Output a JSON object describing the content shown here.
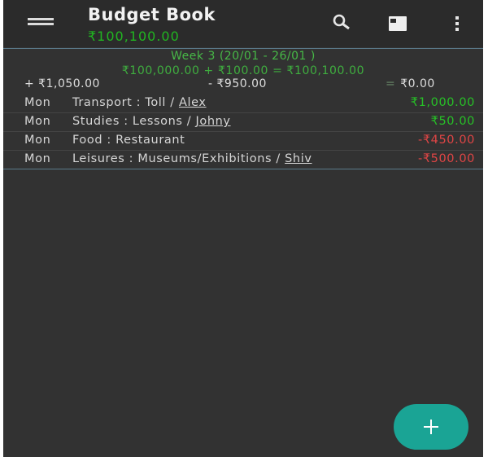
{
  "appbar": {
    "title": "Budget Book",
    "balance": "₹100,100.00"
  },
  "icons": {
    "menu": "menu-icon",
    "search": "search-icon",
    "card": "card-view-icon",
    "more": "more-vert-icon",
    "fab": "plus-icon"
  },
  "week": {
    "title": "Week 3 (20/01 - 26/01 )",
    "formula": "₹100,000.00 + ₹100.00 = ₹100,100.00",
    "income": "+ ₹1,050.00",
    "expense": "- ₹950.00",
    "diff_sign": "=",
    "diff": "₹0.00"
  },
  "transactions": [
    {
      "day": "Mon",
      "desc": "Transport : Toll / ",
      "who": "Alex",
      "amount": "₹1,000.00",
      "type": "income"
    },
    {
      "day": "Mon",
      "desc": "Studies : Lessons / ",
      "who": "Johny",
      "amount": "₹50.00",
      "type": "income"
    },
    {
      "day": "Mon",
      "desc": "Food : Restaurant",
      "who": "",
      "amount": "-₹450.00",
      "type": "expense"
    },
    {
      "day": "Mon",
      "desc": "Leisures : Museums/Exhibitions / ",
      "who": "Shiv",
      "amount": "-₹500.00",
      "type": "expense"
    }
  ],
  "colors": {
    "income": "#27c127",
    "expense": "#e04545",
    "fab": "#1aa495",
    "background": "#323232"
  }
}
